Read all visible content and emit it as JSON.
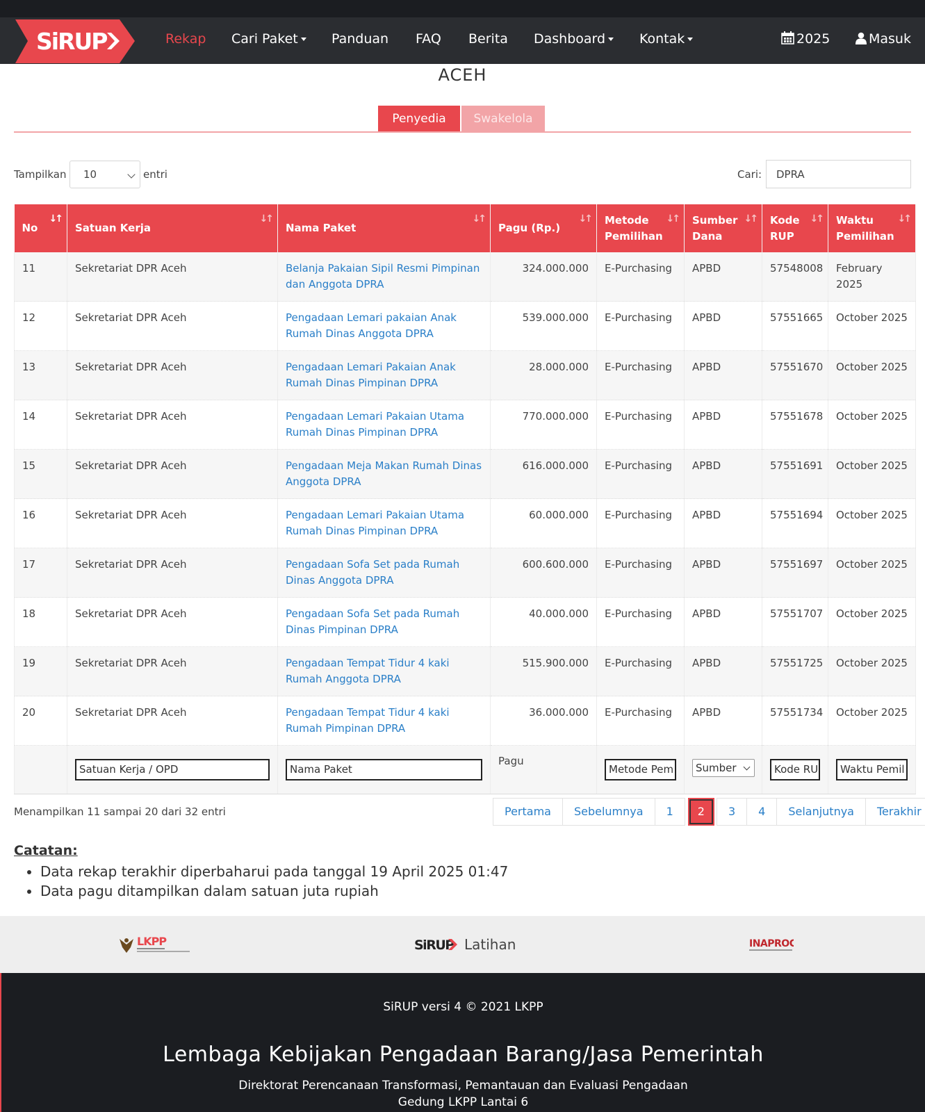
{
  "nav": {
    "logo": "SiRUP",
    "items": [
      {
        "label": "Rekap",
        "active": true,
        "dropdown": false
      },
      {
        "label": "Cari Paket",
        "active": false,
        "dropdown": true
      },
      {
        "label": "Panduan",
        "active": false,
        "dropdown": false
      },
      {
        "label": "FAQ",
        "active": false,
        "dropdown": false
      },
      {
        "label": "Berita",
        "active": false,
        "dropdown": false
      },
      {
        "label": "Dashboard",
        "active": false,
        "dropdown": true
      },
      {
        "label": "Kontak",
        "active": false,
        "dropdown": true
      }
    ],
    "year": "2025",
    "login": "Masuk"
  },
  "region": "ACEH",
  "tabs": {
    "penyedia": "Penyedia",
    "swakelola": "Swakelola"
  },
  "controls": {
    "show_label": "Tampilkan",
    "show_value": "10",
    "entries_label": "entri",
    "search_label": "Cari:",
    "search_value": "DPRA"
  },
  "table": {
    "headers": [
      "No",
      "Satuan Kerja",
      "Nama Paket",
      "Pagu (Rp.)",
      "Metode Pemilihan",
      "Sumber Dana",
      "Kode RUP",
      "Waktu Pemilihan"
    ],
    "rows": [
      {
        "no": "11",
        "satker": "Sekretariat DPR Aceh",
        "paket": "Belanja Pakaian Sipil Resmi Pimpinan dan Anggota DPRA",
        "pagu": "324.000.000",
        "metode": "E-Purchasing",
        "sumber": "APBD",
        "kode": "57548008",
        "waktu": "February 2025"
      },
      {
        "no": "12",
        "satker": "Sekretariat DPR Aceh",
        "paket": "Pengadaan Lemari pakaian Anak Rumah Dinas Anggota DPRA",
        "pagu": "539.000.000",
        "metode": "E-Purchasing",
        "sumber": "APBD",
        "kode": "57551665",
        "waktu": "October 2025"
      },
      {
        "no": "13",
        "satker": "Sekretariat DPR Aceh",
        "paket": "Pengadaan Lemari Pakaian Anak Rumah Dinas Pimpinan DPRA",
        "pagu": "28.000.000",
        "metode": "E-Purchasing",
        "sumber": "APBD",
        "kode": "57551670",
        "waktu": "October 2025"
      },
      {
        "no": "14",
        "satker": "Sekretariat DPR Aceh",
        "paket": "Pengadaan Lemari Pakaian Utama Rumah Dinas Pimpinan DPRA",
        "pagu": "770.000.000",
        "metode": "E-Purchasing",
        "sumber": "APBD",
        "kode": "57551678",
        "waktu": "October 2025"
      },
      {
        "no": "15",
        "satker": "Sekretariat DPR Aceh",
        "paket": "Pengadaan Meja Makan Rumah Dinas Anggota DPRA",
        "pagu": "616.000.000",
        "metode": "E-Purchasing",
        "sumber": "APBD",
        "kode": "57551691",
        "waktu": "October 2025"
      },
      {
        "no": "16",
        "satker": "Sekretariat DPR Aceh",
        "paket": "Pengadaan Lemari Pakaian Utama Rumah Dinas Pimpinan DPRA",
        "pagu": "60.000.000",
        "metode": "E-Purchasing",
        "sumber": "APBD",
        "kode": "57551694",
        "waktu": "October 2025"
      },
      {
        "no": "17",
        "satker": "Sekretariat DPR Aceh",
        "paket": "Pengadaan Sofa Set pada Rumah Dinas Anggota DPRA",
        "pagu": "600.600.000",
        "metode": "E-Purchasing",
        "sumber": "APBD",
        "kode": "57551697",
        "waktu": "October 2025"
      },
      {
        "no": "18",
        "satker": "Sekretariat DPR Aceh",
        "paket": "Pengadaan Sofa Set pada Rumah Dinas Pimpinan DPRA",
        "pagu": "40.000.000",
        "metode": "E-Purchasing",
        "sumber": "APBD",
        "kode": "57551707",
        "waktu": "October 2025"
      },
      {
        "no": "19",
        "satker": "Sekretariat DPR Aceh",
        "paket": "Pengadaan Tempat Tidur 4 kaki Rumah Anggota DPRA",
        "pagu": "515.900.000",
        "metode": "E-Purchasing",
        "sumber": "APBD",
        "kode": "57551725",
        "waktu": "October 2025"
      },
      {
        "no": "20",
        "satker": "Sekretariat DPR Aceh",
        "paket": "Pengadaan Tempat Tidur 4 kaki Rumah Pimpinan DPRA",
        "pagu": "36.000.000",
        "metode": "E-Purchasing",
        "sumber": "APBD",
        "kode": "57551734",
        "waktu": "October 2025"
      }
    ],
    "filters": {
      "satker": "Satuan Kerja / OPD",
      "paket": "Nama Paket",
      "pagu": "Pagu",
      "metode": "Metode Pem",
      "sumber": "Sumber",
      "kode": "Kode RU",
      "waktu": "Waktu Pemil"
    }
  },
  "pagination": {
    "info": "Menampilkan 11 sampai 20 dari 32 entri",
    "first": "Pertama",
    "prev": "Sebelumnya",
    "pages": [
      "1",
      "2",
      "3",
      "4"
    ],
    "current": "2",
    "next": "Selanjutnya",
    "last": "Terakhir"
  },
  "notes": {
    "title": "Catatan:",
    "items": [
      "Data rekap terakhir diperbaharui pada tanggal 19 April 2025 01:47",
      "Data pagu ditampilkan dalam satuan juta rupiah"
    ]
  },
  "partners": {
    "lkpp": "LKPP",
    "sirup": "SiRUP",
    "latihan": "Latihan",
    "inaproc": "INAPROC"
  },
  "footer": {
    "version": "SiRUP versi 4 © 2021 LKPP",
    "org": "Lembaga Kebijakan Pengadaan Barang/Jasa Pemerintah",
    "dept": "Direktorat Perencanaan Transformasi, Pemantauan dan Evaluasi Pengadaan",
    "building": "Gedung LKPP Lantai 6"
  },
  "colors": {
    "accent": "#e8474d",
    "link": "#2a7fc8",
    "navbar": "#2b2d31"
  }
}
